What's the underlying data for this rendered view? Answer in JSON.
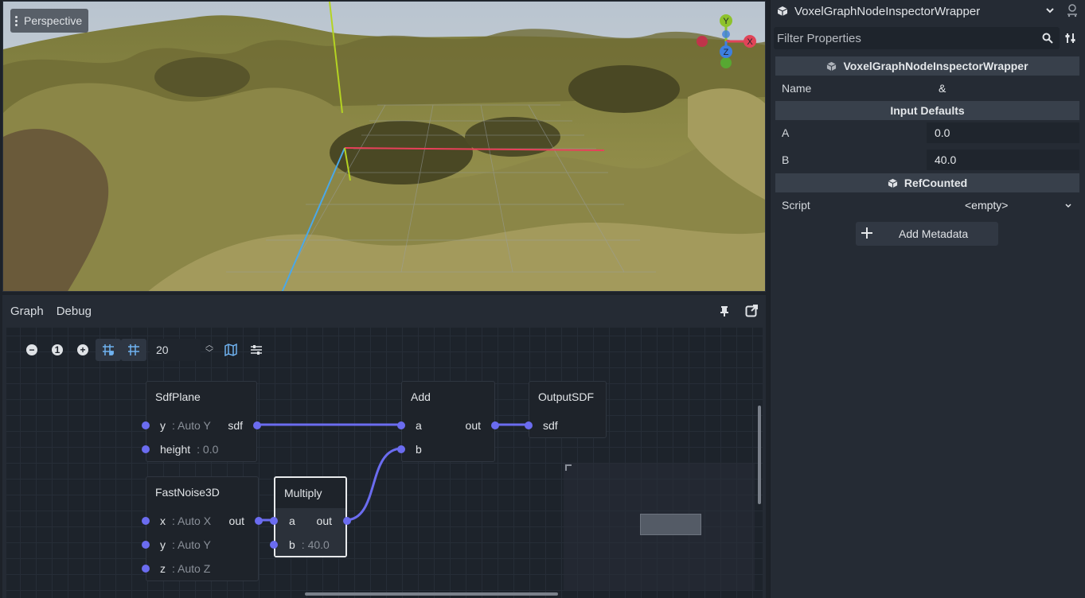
{
  "viewport": {
    "mode_label": "Perspective",
    "gizmo": {
      "y": "Y",
      "x": "X",
      "z": "Z"
    }
  },
  "dock": {
    "tabs": [
      "Graph",
      "Debug"
    ]
  },
  "graph_toolbar": {
    "zoom_out": "−",
    "zoom_reset": "1",
    "zoom_in": "+",
    "snap_value": "20"
  },
  "nodes": {
    "sdfplane": {
      "title": "SdfPlane",
      "in_y": "y",
      "in_y_hint": ": Auto Y",
      "out_sdf": "sdf",
      "in_height": "height",
      "in_height_hint": ": 0.0"
    },
    "add": {
      "title": "Add",
      "in_a": "a",
      "in_b": "b",
      "out": "out"
    },
    "outputsdf": {
      "title": "OutputSDF",
      "in_sdf": "sdf"
    },
    "fastnoise": {
      "title": "FastNoise3D",
      "in_x": "x",
      "in_x_hint": ": Auto X",
      "out": "out",
      "in_y": "y",
      "in_y_hint": ": Auto Y",
      "in_z": "z",
      "in_z_hint": ": Auto Z"
    },
    "multiply": {
      "title": "Multiply",
      "in_a": "a",
      "out": "out",
      "in_b": "b",
      "in_b_hint": ": 40.0"
    }
  },
  "inspector": {
    "object_name": "VoxelGraphNodeInspectorWrapper",
    "filter_placeholder": "Filter Properties",
    "section_main": "VoxelGraphNodeInspectorWrapper",
    "name_label": "Name",
    "name_value": "&",
    "section_inputs": "Input Defaults",
    "a_label": "A",
    "a_value": "0.0",
    "b_label": "B",
    "b_value": "40.0",
    "section_ref": "RefCounted",
    "script_label": "Script",
    "script_value": "<empty>",
    "add_metadata": "Add Metadata"
  },
  "colors": {
    "port": "#6b6cf0",
    "wire": "#6b6cf0",
    "panel": "#252b34",
    "graph_bg": "#1d232b"
  }
}
